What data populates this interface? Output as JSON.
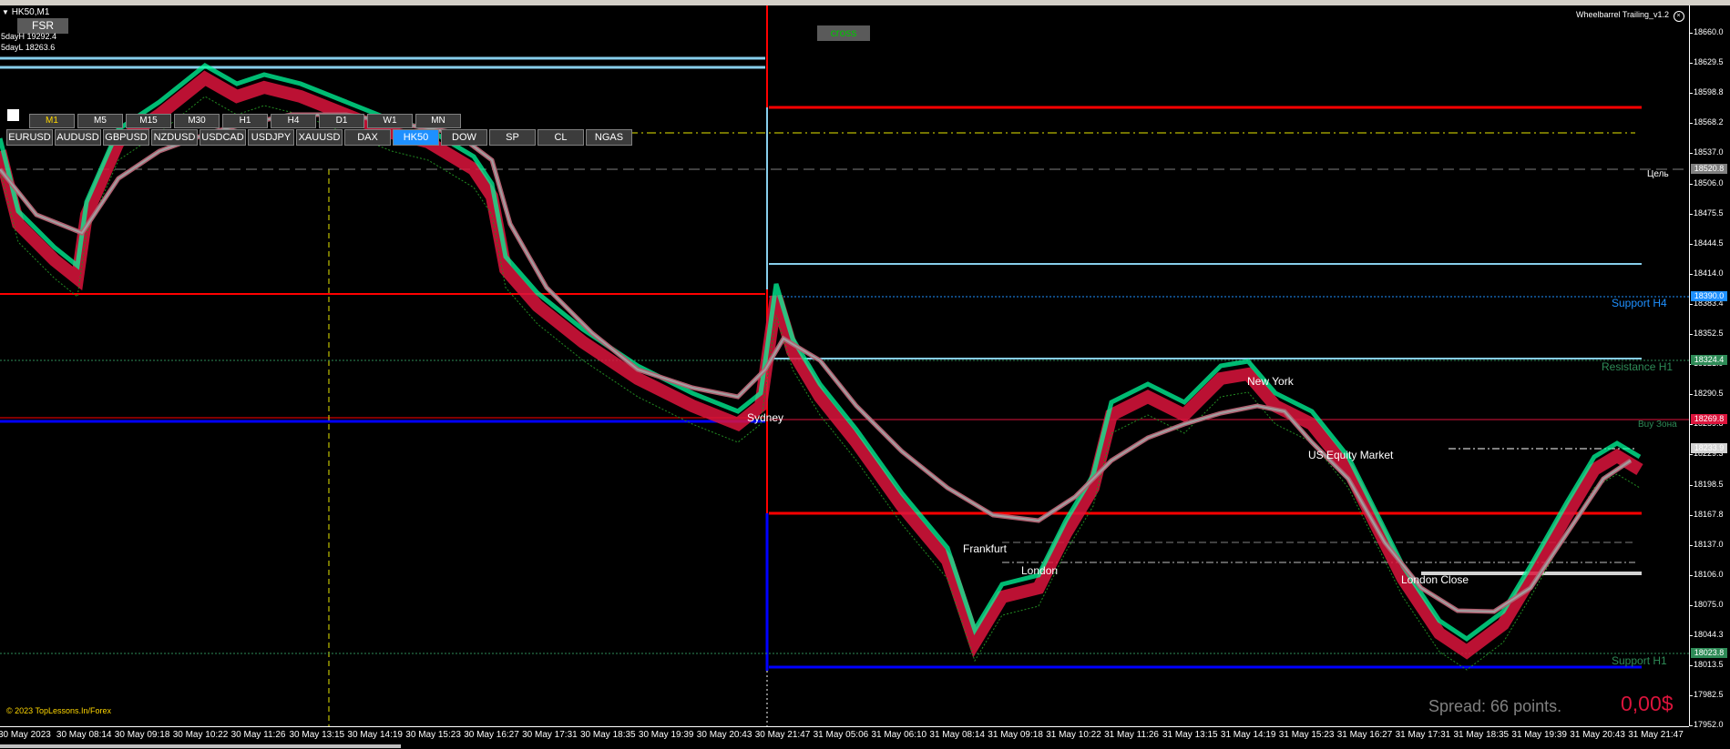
{
  "header": {
    "symbol": "HK50,M1",
    "fsr_button": "FSR",
    "day_high": "5dayH 19292.4",
    "day_low": "5dayL 18263.6",
    "indicator_name": "Wheelbarrel Trailing_v1.2",
    "cross_button": "cross"
  },
  "timeframes": [
    {
      "label": "M1",
      "active": true
    },
    {
      "label": "M5",
      "active": false
    },
    {
      "label": "M15",
      "active": false
    },
    {
      "label": "M30",
      "active": false
    },
    {
      "label": "H1",
      "active": false
    },
    {
      "label": "H4",
      "active": false
    },
    {
      "label": "D1",
      "active": false
    },
    {
      "label": "W1",
      "active": false
    },
    {
      "label": "MN",
      "active": false
    }
  ],
  "symbols": [
    {
      "label": "EURUSD",
      "active": false
    },
    {
      "label": "AUDUSD",
      "active": false
    },
    {
      "label": "GBPUSD",
      "active": false
    },
    {
      "label": "NZDUSD",
      "active": false
    },
    {
      "label": "USDCAD",
      "active": false
    },
    {
      "label": "USDJPY",
      "active": false
    },
    {
      "label": "XAUUSD",
      "active": false
    },
    {
      "label": "DAX",
      "active": false
    },
    {
      "label": "HK50",
      "active": true
    },
    {
      "label": "DOW",
      "active": false
    },
    {
      "label": "SP",
      "active": false
    },
    {
      "label": "CL",
      "active": false
    },
    {
      "label": "NGAS",
      "active": false
    }
  ],
  "sessions": {
    "sydney": "Sydney",
    "frankfurt": "Frankfurt",
    "london": "London",
    "new_york": "New York",
    "us_equity": "US Equity Market",
    "london_close": "London Close"
  },
  "levels": {
    "target": "Цель",
    "support_h4": "Support H4",
    "resistance_h1": "Resistance H1",
    "buy_zone": "Buy Зона",
    "support_h1": "Support H1"
  },
  "footer": {
    "copyright": "© 2023 TopLessons.In/Forex",
    "spread": "Spread: 66 points.",
    "profit": "0,00$"
  },
  "price_axis": {
    "labels": [
      "18660.0",
      "18629.5",
      "18598.8",
      "18568.2",
      "18537.0",
      "18506.0",
      "18475.5",
      "18444.5",
      "18414.0",
      "18383.4",
      "18352.5",
      "18321.9",
      "18290.5",
      "18259.8",
      "18229.3",
      "18198.5",
      "18167.8",
      "18137.0",
      "18106.0",
      "18075.0",
      "18044.3",
      "18013.5",
      "17982.5",
      "17952.0"
    ],
    "tags": [
      {
        "value": "18520.8",
        "color": "#808080"
      },
      {
        "value": "18390.0",
        "color": "#1e90ff"
      },
      {
        "value": "18324.4",
        "color": "#2e8b57"
      },
      {
        "value": "18269.8",
        "color": "#dc143c"
      },
      {
        "value": "18233.9",
        "color": "#d3d3d3"
      },
      {
        "value": "18023.8",
        "color": "#2e8b57"
      }
    ]
  },
  "time_axis": {
    "labels": [
      "30 May 2023",
      "30 May 08:14",
      "30 May 09:18",
      "30 May 10:22",
      "30 May 11:26",
      "30 May 13:15",
      "30 May 14:19",
      "30 May 15:23",
      "30 May 16:27",
      "30 May 17:31",
      "30 May 18:35",
      "30 May 19:39",
      "30 May 20:43",
      "30 May 21:47",
      "31 May 05:06",
      "31 May 06:10",
      "31 May 08:14",
      "31 May 09:18",
      "31 May 10:22",
      "31 May 11:26",
      "31 May 13:15",
      "31 May 14:19",
      "31 May 15:23",
      "31 May 16:27",
      "31 May 17:31",
      "31 May 18:35",
      "31 May 19:39",
      "31 May 20:43",
      "31 May 21:47"
    ]
  },
  "colors": {
    "bull": "#00fa9a",
    "bear": "#dc143c",
    "trail": "#a0a0a0",
    "support": "#87ceeb",
    "resistance": "#ff0000",
    "low": "#0000ff",
    "active_button": "#1e90ff"
  }
}
